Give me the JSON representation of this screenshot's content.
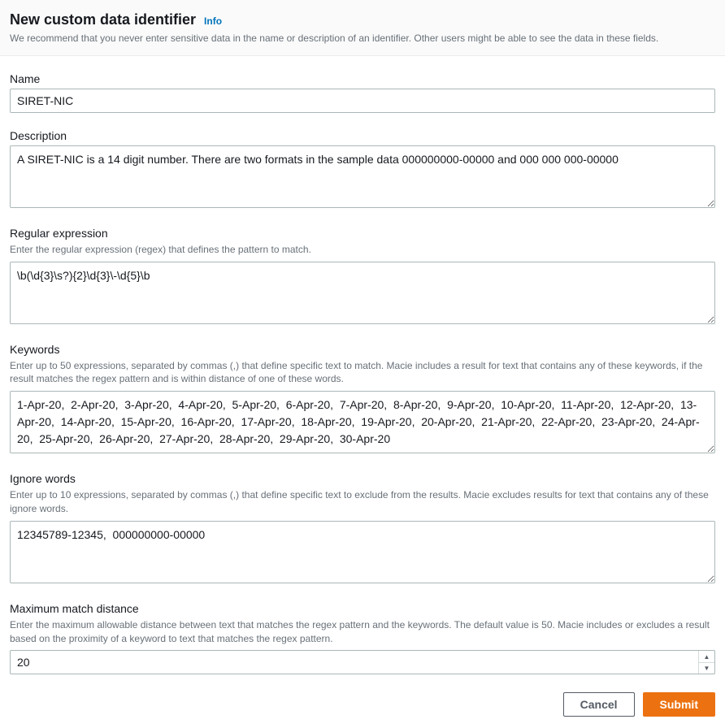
{
  "header": {
    "title": "New custom data identifier",
    "info_label": "Info",
    "subtitle": "We recommend that you never enter sensitive data in the name or description of an identifier. Other users might be able to see the data in these fields."
  },
  "name": {
    "label": "Name",
    "value": "SIRET-NIC"
  },
  "description": {
    "label": "Description",
    "value": "A SIRET-NIC is a 14 digit number. There are two formats in the sample data 000000000-00000 and 000 000 000-00000"
  },
  "regex": {
    "label": "Regular expression",
    "hint": "Enter the regular expression (regex) that defines the pattern to match.",
    "value": "\\b(\\d{3}\\s?){2}\\d{3}\\-\\d{5}\\b"
  },
  "keywords": {
    "label": "Keywords",
    "hint": "Enter up to 50 expressions, separated by commas (,) that define specific text to match. Macie includes a result for text that contains any of these keywords, if the result matches the regex pattern and is within distance of one of these words.",
    "value": "1-Apr-20,  2-Apr-20,  3-Apr-20,  4-Apr-20,  5-Apr-20,  6-Apr-20,  7-Apr-20,  8-Apr-20,  9-Apr-20,  10-Apr-20,  11-Apr-20,  12-Apr-20,  13-Apr-20,  14-Apr-20,  15-Apr-20,  16-Apr-20,  17-Apr-20,  18-Apr-20,  19-Apr-20,  20-Apr-20,  21-Apr-20,  22-Apr-20,  23-Apr-20,  24-Apr-20,  25-Apr-20,  26-Apr-20,  27-Apr-20,  28-Apr-20,  29-Apr-20,  30-Apr-20"
  },
  "ignore_words": {
    "label": "Ignore words",
    "hint": "Enter up to 10 expressions, separated by commas (,) that define specific text to exclude from the results. Macie excludes results for text that contains any of these ignore words.",
    "value": "12345789-12345,  000000000-00000"
  },
  "max_match_distance": {
    "label": "Maximum match distance",
    "hint": "Enter the maximum allowable distance between text that matches the regex pattern and the keywords. The default value is 50. Macie includes or excludes a result based on the proximity of a keyword to text that matches the regex pattern.",
    "value": "20"
  },
  "actions": {
    "cancel": "Cancel",
    "submit": "Submit"
  }
}
